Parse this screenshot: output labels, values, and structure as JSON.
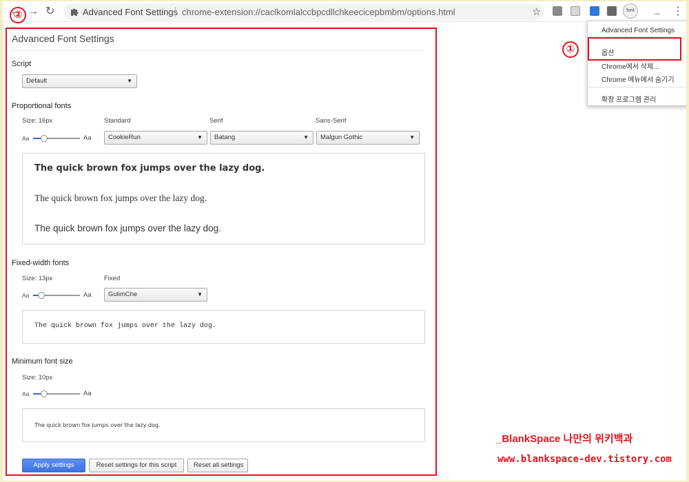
{
  "browser": {
    "back_icon": "←",
    "forward_icon": "→",
    "reload_icon": "↻",
    "page_title": "Advanced Font Settings",
    "url": "chrome-extension://caclkomlalccbpcdllchkeecicepbmbm/options.html",
    "star_icon": "☆",
    "ext_font_label": "font",
    "menu_icon": "⋮",
    "minimize_icon": "_"
  },
  "context_menu": {
    "items": [
      "Advanced Font Settings",
      "옵션",
      "Chrome에서 삭제...",
      "Chrome 메뉴에서 숨기기",
      "확장 프로그램 관리"
    ]
  },
  "annotations": {
    "marker_1": "①",
    "marker_2": "②"
  },
  "settings": {
    "title": "Advanced Font Settings",
    "script": {
      "label": "Script",
      "value": "Default"
    },
    "proportional": {
      "label": "Proportional fonts",
      "size_label": "Size: 16px",
      "slider_min": "Aa",
      "slider_max": "Aa",
      "standard_label": "Standard",
      "standard_value": "CookieRun",
      "serif_label": "Serif",
      "serif_value": "Batang",
      "sans_label": "Sans-Serif",
      "sans_value": "Malgun Gothic",
      "preview_standard": "The quick brown fox jumps over the lazy dog.",
      "preview_serif": "The quick brown fox jumps over the lazy dog.",
      "preview_sans": "The quick brown fox jumps over the lazy dog."
    },
    "fixed": {
      "label": "Fixed-width fonts",
      "size_label": "Size: 13px",
      "slider_min": "Aa",
      "slider_max": "Aa",
      "fixed_label": "Fixed",
      "fixed_value": "GulimChe",
      "preview": "The quick brown fox jumps over the lazy dog."
    },
    "minimum": {
      "label": "Minimum font size",
      "size_label": "Size: 10px",
      "slider_min": "Aa",
      "slider_max": "Aa",
      "preview": "The quick brown fox jumps over the lazy dog."
    },
    "buttons": {
      "apply": "Apply settings",
      "reset_script": "Reset settings for this script",
      "reset_all": "Reset all settings"
    }
  },
  "watermark": {
    "line1": "_BlankSpace 나만의 위키백과",
    "line2": "www.blankspace-dev.tistory.com"
  }
}
